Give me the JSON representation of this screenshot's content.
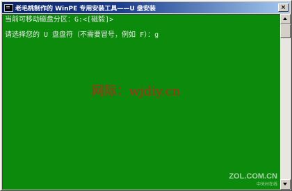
{
  "window": {
    "title": "老毛桃制作的 WinPE 专用安装工具——U 盘安装",
    "close_glyph": "×"
  },
  "console": {
    "line1": "当前可移动磁盘分区：G:<[磁毅]>",
    "line2": "请选择您的 U 盘盘符（不需要冒号，例如 F）：g"
  },
  "watermark": {
    "text": "网际：wjdiy.cn",
    "zol_logo": "ZOL.COM.CN",
    "zol_sub": "中关村在线"
  },
  "colors": {
    "console_bg": "#0b8a0b",
    "console_text": "#e8e8e8",
    "titlebar": "#0a246a",
    "watermark": "#c81e1e"
  }
}
